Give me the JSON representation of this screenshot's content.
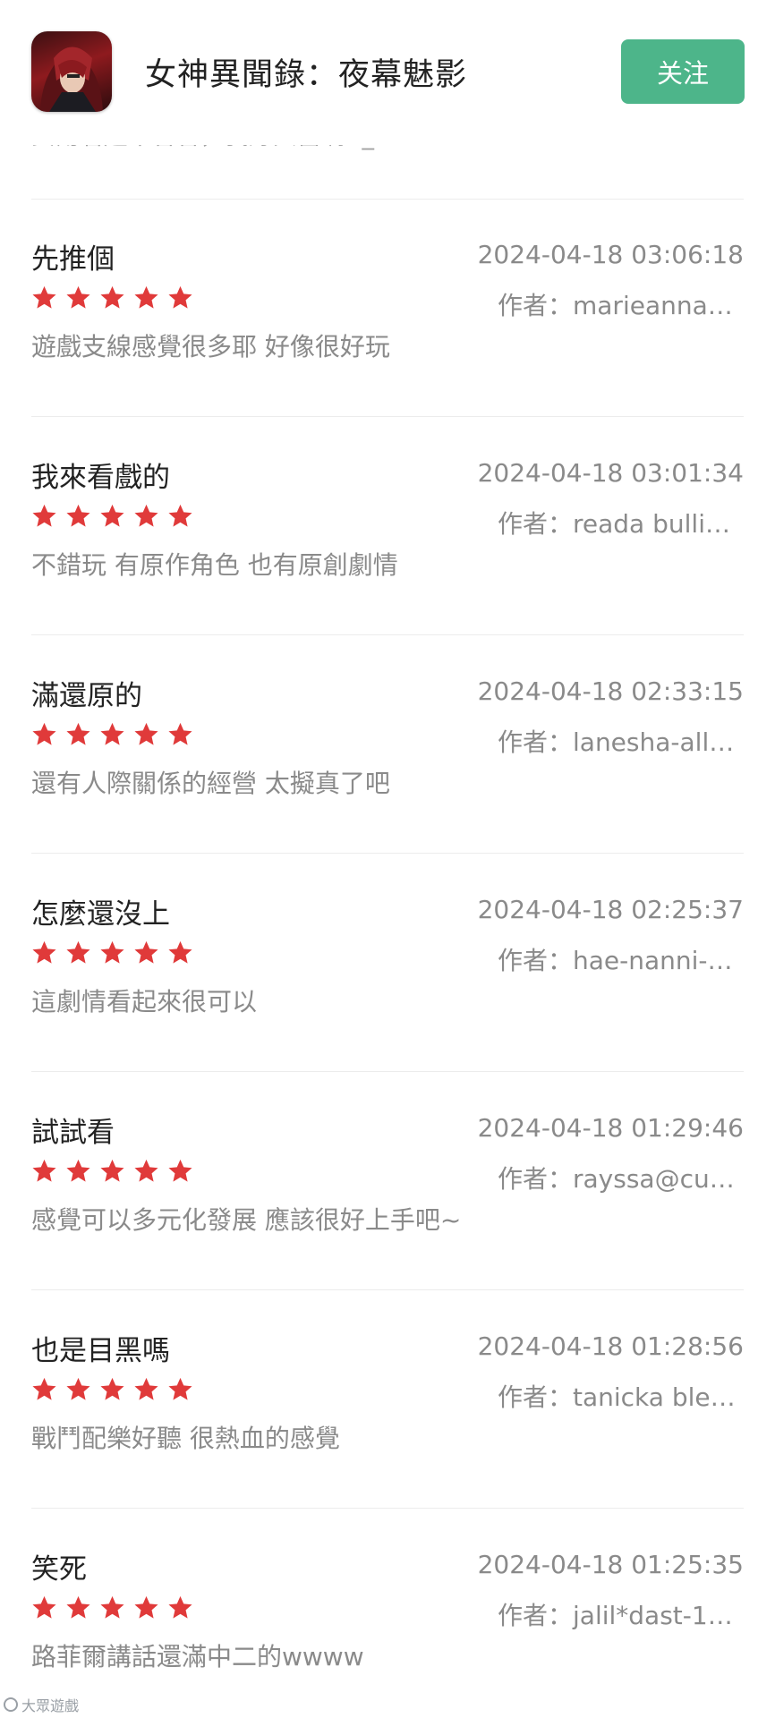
{
  "header": {
    "app_icon": "game-character-icon",
    "title": "女神異聞錄：夜幕魅影",
    "follow_label": "关注",
    "accent_color": "#4db58a"
  },
  "peek_text": "女角看起來香香，我好興奮啊A_A",
  "rating_color": "#e03a3a",
  "reviews": [
    {
      "title": "先推個",
      "date": "2024-04-18 03:06:18",
      "author": "作者：marieanna~...",
      "rating": 5,
      "content": "遊戲支線感覺很多耶 好像很好玩"
    },
    {
      "title": "我來看戲的",
      "date": "2024-04-18 03:01:34",
      "author": "作者：reada bulliva...",
      "rating": 5,
      "content": "不錯玩 有原作角色 也有原創劇情"
    },
    {
      "title": "滿還原的",
      "date": "2024-04-18 02:33:15",
      "author": "作者：lanesha-alld...",
      "rating": 5,
      "content": "還有人際關係的經營 太擬真了吧"
    },
    {
      "title": "怎麼還沒上",
      "date": "2024-04-18 02:25:37",
      "author": "作者：hae-nanni-1...",
      "rating": 5,
      "content": "這劇情看起來很可以"
    },
    {
      "title": "試試看",
      "date": "2024-04-18 01:29:46",
      "author": "作者：rayssa@cue...",
      "rating": 5,
      "content": "感覺可以多元化發展 應該很好上手吧~"
    },
    {
      "title": "也是目黑嗎",
      "date": "2024-04-18 01:28:56",
      "author": "作者：tanicka blea...",
      "rating": 5,
      "content": "戰鬥配樂好聽 很熱血的感覺"
    },
    {
      "title": "笑死",
      "date": "2024-04-18 01:25:35",
      "author": "作者：jalil*dast-19...",
      "rating": 5,
      "content": "路菲爾講話還滿中二的wwww"
    }
  ],
  "watermark": "大眾遊戲"
}
